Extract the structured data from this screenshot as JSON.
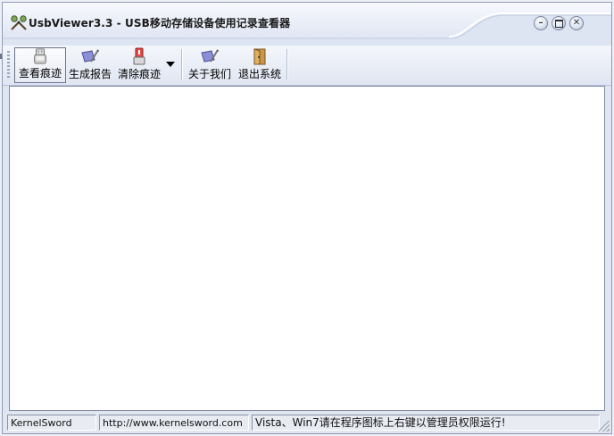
{
  "window": {
    "title": "UsbViewer3.3 - USB移动存储设备使用记录查看器"
  },
  "toolbar": {
    "buttons": [
      {
        "label": "查看痕迹",
        "icon": "usb-drive-icon"
      },
      {
        "label": "生成报告",
        "icon": "report-pen-icon"
      },
      {
        "label": "清除痕迹",
        "icon": "clear-usb-icon"
      },
      {
        "label": "关于我们",
        "icon": "about-pen-icon"
      },
      {
        "label": "退出系统",
        "icon": "exit-door-icon"
      }
    ]
  },
  "statusbar": {
    "author": "KernelSword",
    "website": "http://www.kernelsword.com",
    "hint": "Vista、Win7请在程序图标上右键以管理员权限运行!"
  },
  "colors": {
    "accent": "#dfe5f1",
    "border": "#8d9bb8"
  }
}
